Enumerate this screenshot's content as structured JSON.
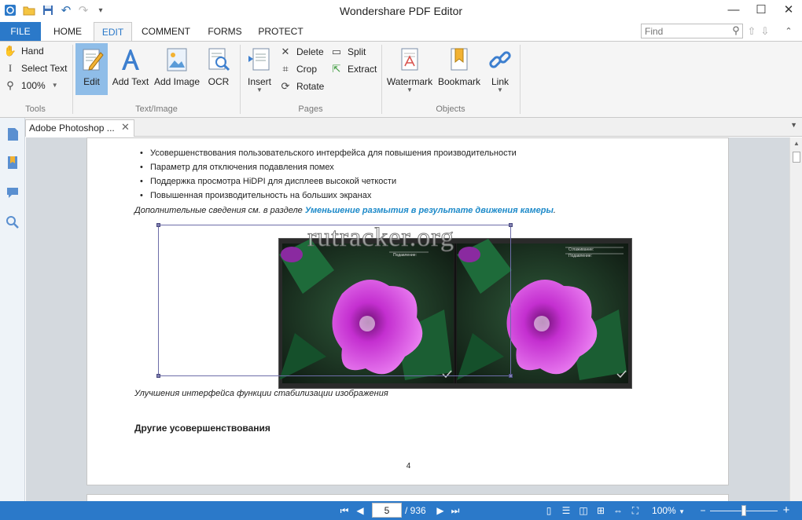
{
  "app": {
    "title": "Wondershare PDF Editor",
    "accent_color": "#2b79c9"
  },
  "quick_access": {
    "icons": [
      "app-logo-icon",
      "open-folder-icon",
      "save-icon",
      "undo-icon",
      "redo-icon",
      "customize-icon"
    ]
  },
  "window_controls": {
    "minimize": "—",
    "maximize": "☐",
    "close": "✕"
  },
  "tabs": [
    {
      "label": "FILE"
    },
    {
      "label": "HOME"
    },
    {
      "label": "EDIT"
    },
    {
      "label": "COMMENT"
    },
    {
      "label": "FORMS"
    },
    {
      "label": "PROTECT"
    }
  ],
  "search": {
    "placeholder": "Find"
  },
  "ribbon": {
    "tools": {
      "group_label": "Tools",
      "hand": "Hand",
      "select_text": "Select Text",
      "zoom": "100%"
    },
    "text_image": {
      "group_label": "Text/Image",
      "edit": "Edit",
      "add_text": "Add Text",
      "add_image": "Add Image",
      "ocr": "OCR"
    },
    "pages": {
      "group_label": "Pages",
      "insert": "Insert",
      "delete": "Delete",
      "crop": "Crop",
      "rotate": "Rotate",
      "split": "Split",
      "extract": "Extract"
    },
    "objects": {
      "group_label": "Objects",
      "watermark": "Watermark",
      "bookmark": "Bookmark",
      "link": "Link"
    }
  },
  "document_tab": {
    "label": "Adobe Photoshop ..."
  },
  "document": {
    "bullets": [
      "Усовершенствования пользовательского интерфейса для повышения производительности",
      "Параметр для отключения подавления помех",
      "Поддержка просмотра HiDPI для дисплеев высокой четкости",
      "Повышенная производительность на больших экранах"
    ],
    "note_prefix": "Дополнительные сведения см. в разделе ",
    "note_link": "Уменьшение размытия в результате движения камеры",
    "note_suffix": ".",
    "image_caption": "Улучшения интерфейса функции стабилизации изображения",
    "heading": "Другие усовершенствования",
    "page_number": "4",
    "watermark_text": "rutracker.org",
    "panel_left_label": "Подавление:",
    "panel_right_label_1": "Сглаживание:",
    "panel_right_label_2": "Подавление:"
  },
  "status": {
    "current_page": "5",
    "total_pages": "/ 936",
    "zoom": "100%",
    "zoom_fraction": 0.5
  }
}
